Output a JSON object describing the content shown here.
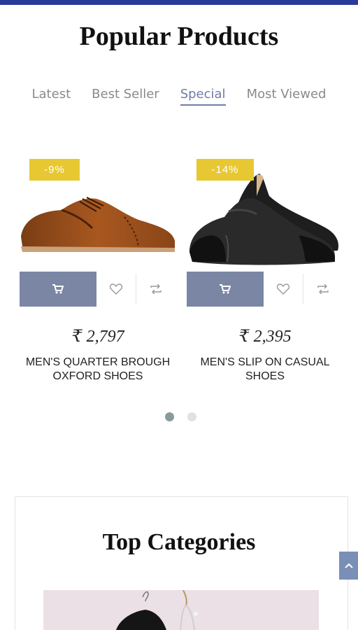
{
  "popular": {
    "title": "Popular Products",
    "tabs": [
      {
        "label": "Latest"
      },
      {
        "label": "Best Seller"
      },
      {
        "label": "Special"
      },
      {
        "label": "Most Viewed"
      }
    ],
    "active_tab": "Special",
    "products": [
      {
        "discount": "-9%",
        "price": "₹ 2,797",
        "name": "MEN'S QUARTER BROUGH OXFORD SHOES",
        "image_icon": "brown-brogue-oxford-shoe"
      },
      {
        "discount": "-14%",
        "price": "₹ 2,395",
        "name": "MEN'S SLIP ON CASUAL SHOES",
        "image_icon": "black-suede-slip-on-shoes"
      }
    ],
    "pagination": {
      "pages": 2,
      "current": 1
    }
  },
  "categories": {
    "title": "Top Categories"
  },
  "colors": {
    "accent": "#2a3a9a",
    "button": "#7a86a3",
    "badge": "#e8c832",
    "active_tab": "#6f7ca6"
  },
  "icons": {
    "cart": "cart-icon",
    "wishlist": "heart-icon",
    "compare": "compare-icon",
    "scroll_top": "chevron-up-icon"
  }
}
